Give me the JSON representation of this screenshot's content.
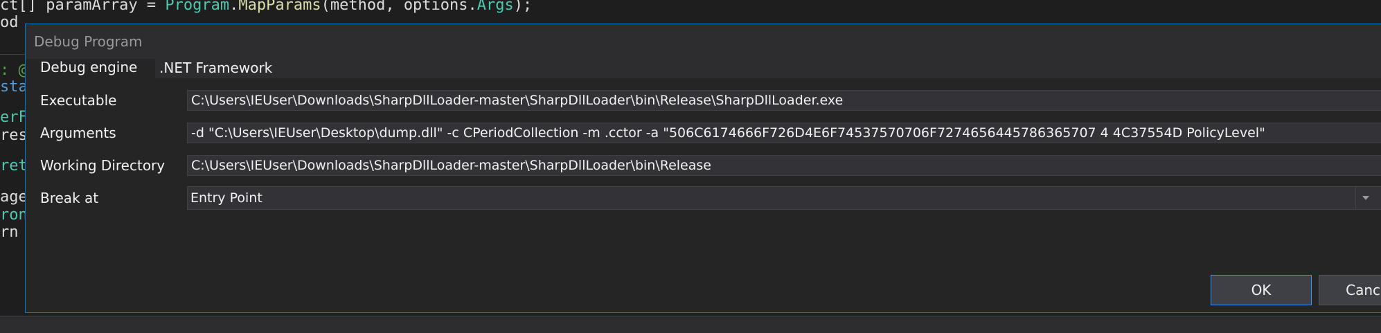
{
  "editor": {
    "lines": [
      {
        "parts": [
          [
            "plain",
            "ct[] paramArray = "
          ],
          [
            "type",
            "Program"
          ],
          [
            "plain",
            "."
          ],
          [
            "method",
            "MapParams"
          ],
          [
            "plain",
            "(method, options."
          ],
          [
            "prop",
            "Args"
          ],
          [
            "plain",
            ");"
          ]
        ]
      },
      {
        "parts": [
          [
            "plain",
            "od"
          ]
        ]
      },
      {
        "parts": [
          [
            "cmt",
            ": @"
          ]
        ]
      },
      {
        "parts": [
          [
            "key",
            "sta"
          ]
        ]
      },
      {
        "parts": [
          [
            "type",
            "erF"
          ]
        ]
      },
      {
        "parts": [
          [
            "plain",
            "res"
          ]
        ]
      },
      {
        "parts": [
          [
            "type",
            "ret"
          ]
        ]
      },
      {
        "parts": [
          [
            "plain",
            "age"
          ]
        ]
      },
      {
        "parts": [
          [
            "type",
            "ron"
          ]
        ]
      },
      {
        "parts": [
          [
            "plain",
            "rn"
          ]
        ]
      }
    ]
  },
  "dialog": {
    "title": "Debug Program",
    "rows": {
      "engine": {
        "label": "Debug engine",
        "value": ".NET Framework"
      },
      "executable": {
        "label": "Executable",
        "value": "C:\\Users\\IEUser\\Downloads\\SharpDllLoader-master\\SharpDllLoader\\bin\\Release\\SharpDllLoader.exe"
      },
      "arguments": {
        "label": "Arguments",
        "value": "-d \"C:\\Users\\IEUser\\Desktop\\dump.dll\" -c CPeriodCollection -m .cctor -a \"506C6174666F726D4E6F74537570706F7274656445786365707 4 4C37554D PolicyLevel\""
      },
      "working_directory": {
        "label": "Working Directory",
        "value": "C:\\Users\\IEUser\\Downloads\\SharpDllLoader-master\\SharpDllLoader\\bin\\Release"
      },
      "break_at": {
        "label": "Break at",
        "value": "Entry Point"
      }
    },
    "buttons": {
      "ok": "OK",
      "cancel": "Cancel"
    }
  }
}
